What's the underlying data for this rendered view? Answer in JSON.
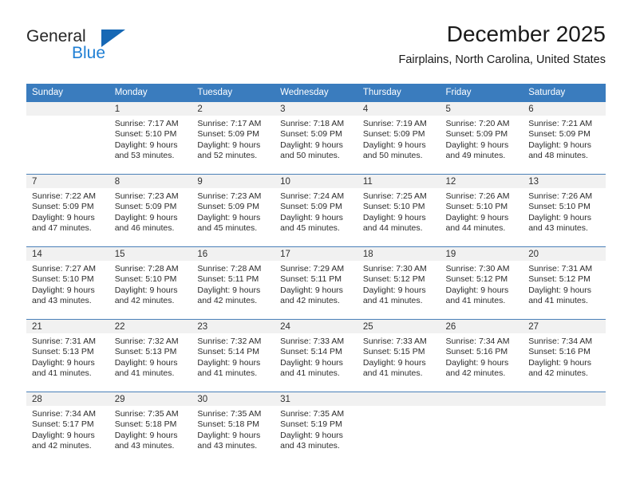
{
  "brand": {
    "word_one": "General",
    "word_two": "Blue",
    "triangle_color": "#1668b5",
    "blue_text_color": "#1f7fd4"
  },
  "header": {
    "title": "December 2025",
    "location": "Fairplains, North Carolina, United States"
  },
  "calendar": {
    "header_bg": "#3a7cbe",
    "daynum_bg": "#f1f1f1",
    "separator_color": "#4a80b8",
    "weekday_headers": [
      "Sunday",
      "Monday",
      "Tuesday",
      "Wednesday",
      "Thursday",
      "Friday",
      "Saturday"
    ],
    "weeks": [
      [
        {
          "day": "",
          "sunrise": "",
          "sunset": "",
          "daylight_1": "",
          "daylight_2": ""
        },
        {
          "day": "1",
          "sunrise": "Sunrise: 7:17 AM",
          "sunset": "Sunset: 5:10 PM",
          "daylight_1": "Daylight: 9 hours",
          "daylight_2": "and 53 minutes."
        },
        {
          "day": "2",
          "sunrise": "Sunrise: 7:17 AM",
          "sunset": "Sunset: 5:09 PM",
          "daylight_1": "Daylight: 9 hours",
          "daylight_2": "and 52 minutes."
        },
        {
          "day": "3",
          "sunrise": "Sunrise: 7:18 AM",
          "sunset": "Sunset: 5:09 PM",
          "daylight_1": "Daylight: 9 hours",
          "daylight_2": "and 50 minutes."
        },
        {
          "day": "4",
          "sunrise": "Sunrise: 7:19 AM",
          "sunset": "Sunset: 5:09 PM",
          "daylight_1": "Daylight: 9 hours",
          "daylight_2": "and 50 minutes."
        },
        {
          "day": "5",
          "sunrise": "Sunrise: 7:20 AM",
          "sunset": "Sunset: 5:09 PM",
          "daylight_1": "Daylight: 9 hours",
          "daylight_2": "and 49 minutes."
        },
        {
          "day": "6",
          "sunrise": "Sunrise: 7:21 AM",
          "sunset": "Sunset: 5:09 PM",
          "daylight_1": "Daylight: 9 hours",
          "daylight_2": "and 48 minutes."
        }
      ],
      [
        {
          "day": "7",
          "sunrise": "Sunrise: 7:22 AM",
          "sunset": "Sunset: 5:09 PM",
          "daylight_1": "Daylight: 9 hours",
          "daylight_2": "and 47 minutes."
        },
        {
          "day": "8",
          "sunrise": "Sunrise: 7:23 AM",
          "sunset": "Sunset: 5:09 PM",
          "daylight_1": "Daylight: 9 hours",
          "daylight_2": "and 46 minutes."
        },
        {
          "day": "9",
          "sunrise": "Sunrise: 7:23 AM",
          "sunset": "Sunset: 5:09 PM",
          "daylight_1": "Daylight: 9 hours",
          "daylight_2": "and 45 minutes."
        },
        {
          "day": "10",
          "sunrise": "Sunrise: 7:24 AM",
          "sunset": "Sunset: 5:09 PM",
          "daylight_1": "Daylight: 9 hours",
          "daylight_2": "and 45 minutes."
        },
        {
          "day": "11",
          "sunrise": "Sunrise: 7:25 AM",
          "sunset": "Sunset: 5:10 PM",
          "daylight_1": "Daylight: 9 hours",
          "daylight_2": "and 44 minutes."
        },
        {
          "day": "12",
          "sunrise": "Sunrise: 7:26 AM",
          "sunset": "Sunset: 5:10 PM",
          "daylight_1": "Daylight: 9 hours",
          "daylight_2": "and 44 minutes."
        },
        {
          "day": "13",
          "sunrise": "Sunrise: 7:26 AM",
          "sunset": "Sunset: 5:10 PM",
          "daylight_1": "Daylight: 9 hours",
          "daylight_2": "and 43 minutes."
        }
      ],
      [
        {
          "day": "14",
          "sunrise": "Sunrise: 7:27 AM",
          "sunset": "Sunset: 5:10 PM",
          "daylight_1": "Daylight: 9 hours",
          "daylight_2": "and 43 minutes."
        },
        {
          "day": "15",
          "sunrise": "Sunrise: 7:28 AM",
          "sunset": "Sunset: 5:10 PM",
          "daylight_1": "Daylight: 9 hours",
          "daylight_2": "and 42 minutes."
        },
        {
          "day": "16",
          "sunrise": "Sunrise: 7:28 AM",
          "sunset": "Sunset: 5:11 PM",
          "daylight_1": "Daylight: 9 hours",
          "daylight_2": "and 42 minutes."
        },
        {
          "day": "17",
          "sunrise": "Sunrise: 7:29 AM",
          "sunset": "Sunset: 5:11 PM",
          "daylight_1": "Daylight: 9 hours",
          "daylight_2": "and 42 minutes."
        },
        {
          "day": "18",
          "sunrise": "Sunrise: 7:30 AM",
          "sunset": "Sunset: 5:12 PM",
          "daylight_1": "Daylight: 9 hours",
          "daylight_2": "and 41 minutes."
        },
        {
          "day": "19",
          "sunrise": "Sunrise: 7:30 AM",
          "sunset": "Sunset: 5:12 PM",
          "daylight_1": "Daylight: 9 hours",
          "daylight_2": "and 41 minutes."
        },
        {
          "day": "20",
          "sunrise": "Sunrise: 7:31 AM",
          "sunset": "Sunset: 5:12 PM",
          "daylight_1": "Daylight: 9 hours",
          "daylight_2": "and 41 minutes."
        }
      ],
      [
        {
          "day": "21",
          "sunrise": "Sunrise: 7:31 AM",
          "sunset": "Sunset: 5:13 PM",
          "daylight_1": "Daylight: 9 hours",
          "daylight_2": "and 41 minutes."
        },
        {
          "day": "22",
          "sunrise": "Sunrise: 7:32 AM",
          "sunset": "Sunset: 5:13 PM",
          "daylight_1": "Daylight: 9 hours",
          "daylight_2": "and 41 minutes."
        },
        {
          "day": "23",
          "sunrise": "Sunrise: 7:32 AM",
          "sunset": "Sunset: 5:14 PM",
          "daylight_1": "Daylight: 9 hours",
          "daylight_2": "and 41 minutes."
        },
        {
          "day": "24",
          "sunrise": "Sunrise: 7:33 AM",
          "sunset": "Sunset: 5:14 PM",
          "daylight_1": "Daylight: 9 hours",
          "daylight_2": "and 41 minutes."
        },
        {
          "day": "25",
          "sunrise": "Sunrise: 7:33 AM",
          "sunset": "Sunset: 5:15 PM",
          "daylight_1": "Daylight: 9 hours",
          "daylight_2": "and 41 minutes."
        },
        {
          "day": "26",
          "sunrise": "Sunrise: 7:34 AM",
          "sunset": "Sunset: 5:16 PM",
          "daylight_1": "Daylight: 9 hours",
          "daylight_2": "and 42 minutes."
        },
        {
          "day": "27",
          "sunrise": "Sunrise: 7:34 AM",
          "sunset": "Sunset: 5:16 PM",
          "daylight_1": "Daylight: 9 hours",
          "daylight_2": "and 42 minutes."
        }
      ],
      [
        {
          "day": "28",
          "sunrise": "Sunrise: 7:34 AM",
          "sunset": "Sunset: 5:17 PM",
          "daylight_1": "Daylight: 9 hours",
          "daylight_2": "and 42 minutes."
        },
        {
          "day": "29",
          "sunrise": "Sunrise: 7:35 AM",
          "sunset": "Sunset: 5:18 PM",
          "daylight_1": "Daylight: 9 hours",
          "daylight_2": "and 43 minutes."
        },
        {
          "day": "30",
          "sunrise": "Sunrise: 7:35 AM",
          "sunset": "Sunset: 5:18 PM",
          "daylight_1": "Daylight: 9 hours",
          "daylight_2": "and 43 minutes."
        },
        {
          "day": "31",
          "sunrise": "Sunrise: 7:35 AM",
          "sunset": "Sunset: 5:19 PM",
          "daylight_1": "Daylight: 9 hours",
          "daylight_2": "and 43 minutes."
        },
        {
          "day": "",
          "sunrise": "",
          "sunset": "",
          "daylight_1": "",
          "daylight_2": ""
        },
        {
          "day": "",
          "sunrise": "",
          "sunset": "",
          "daylight_1": "",
          "daylight_2": ""
        },
        {
          "day": "",
          "sunrise": "",
          "sunset": "",
          "daylight_1": "",
          "daylight_2": ""
        }
      ]
    ]
  }
}
